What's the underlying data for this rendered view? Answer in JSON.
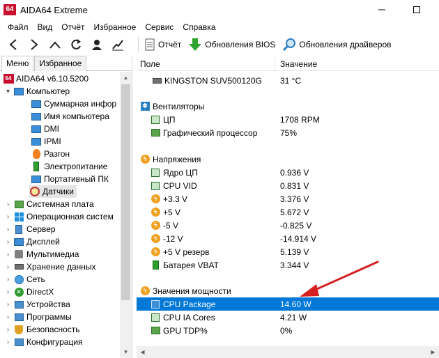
{
  "window": {
    "logo_text": "64",
    "title": "AIDA64 Extreme"
  },
  "menu": [
    "Файл",
    "Вид",
    "Отчёт",
    "Избранное",
    "Сервис",
    "Справка"
  ],
  "toolbar": {
    "report_label": "Отчёт",
    "bios_label": "Обновления BIOS",
    "drivers_label": "Обновления драйверов"
  },
  "tabs": {
    "menu": "Меню",
    "favorites": "Избранное"
  },
  "tree": {
    "root_logo": "64",
    "root": "AIDA64 v6.10.5200",
    "computer": "Компьютер",
    "computer_children": [
      "Суммарная инфор",
      "Имя компьютера",
      "DMI",
      "IPMI",
      "Разгон",
      "Электропитание",
      "Портативный ПК",
      "Датчики"
    ],
    "top_level": [
      "Системная плата",
      "Операционная систем",
      "Сервер",
      "Дисплей",
      "Мультимедиа",
      "Хранение данных",
      "Сеть",
      "DirectX",
      "Устройства",
      "Программы",
      "Безопасность",
      "Конфигурация"
    ]
  },
  "columns": {
    "field": "Поле",
    "value": "Значение"
  },
  "sensors": {
    "disk": {
      "name": "KINGSTON SUV500120G",
      "value": "31 °C"
    },
    "fans_group": "Вентиляторы",
    "fans": [
      {
        "name": "ЦП",
        "value": "1708 RPM"
      },
      {
        "name": "Графический процессор",
        "value": "75%"
      }
    ],
    "voltages_group": "Напряжения",
    "voltages": [
      {
        "name": "Ядро ЦП",
        "value": "0.936 V"
      },
      {
        "name": "CPU VID",
        "value": "0.831 V"
      },
      {
        "name": "+3.3 V",
        "value": "3.376 V"
      },
      {
        "name": "+5 V",
        "value": "5.672 V"
      },
      {
        "name": "-5 V",
        "value": "-0.825 V"
      },
      {
        "name": "-12 V",
        "value": "-14.914 V"
      },
      {
        "name": "+5 V резерв",
        "value": "5.139 V"
      },
      {
        "name": "Батарея VBAT",
        "value": "3.344 V"
      }
    ],
    "power_group": "Значения мощности",
    "power": [
      {
        "name": "CPU Package",
        "value": "14.60 W"
      },
      {
        "name": "CPU IA Cores",
        "value": "4.21 W"
      },
      {
        "name": "GPU TDP%",
        "value": "0%"
      }
    ]
  },
  "colors": {
    "selection": "#0078d7",
    "annotation_arrow": "#d42020"
  }
}
